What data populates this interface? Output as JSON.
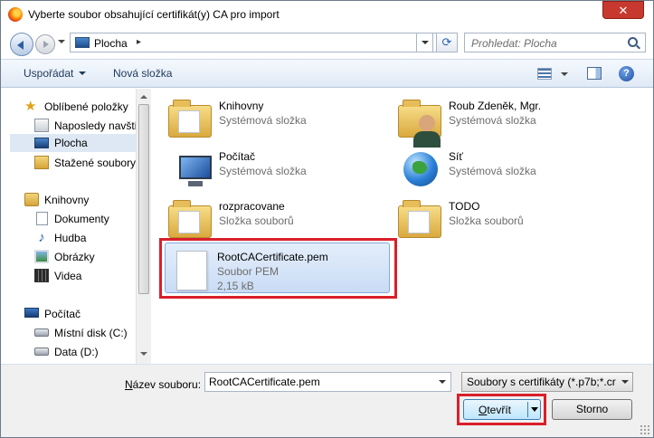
{
  "window": {
    "title": "Vyberte soubor obsahující certifikát(y) CA pro import",
    "close_label": "✕"
  },
  "address": {
    "location": "Plocha",
    "separator": "▸"
  },
  "search": {
    "placeholder": "Prohledat: Plocha"
  },
  "toolbar": {
    "organize_label": "Uspořádat",
    "new_folder_label": "Nová složka",
    "help_label": "?"
  },
  "sidebar": {
    "items": [
      {
        "label": "Oblíbené položky",
        "icon": "star-icon"
      },
      {
        "label": "Naposledy navšti",
        "icon": "recent-places-icon"
      },
      {
        "label": "Plocha",
        "icon": "desktop-icon",
        "selected": true
      },
      {
        "label": "Stažené soubory",
        "icon": "downloads-icon"
      },
      {
        "label": "Knihovny",
        "icon": "libraries-icon"
      },
      {
        "label": "Dokumenty",
        "icon": "documents-icon"
      },
      {
        "label": "Hudba",
        "icon": "music-icon"
      },
      {
        "label": "Obrázky",
        "icon": "pictures-icon"
      },
      {
        "label": "Videa",
        "icon": "videos-icon"
      },
      {
        "label": "Počítač",
        "icon": "computer-icon"
      },
      {
        "label": "Místní disk (C:)",
        "icon": "disk-icon"
      },
      {
        "label": "Data (D:)",
        "icon": "disk-icon"
      }
    ]
  },
  "files": [
    {
      "name": "Knihovny",
      "type": "Systémová složka",
      "icon": "libraries-folder-icon"
    },
    {
      "name": "Roub Zdeněk, Mgr.",
      "type": "Systémová složka",
      "icon": "user-folder-icon"
    },
    {
      "name": "Počítač",
      "type": "Systémová složka",
      "icon": "computer-icon"
    },
    {
      "name": "Síť",
      "type": "Systémová složka",
      "icon": "network-icon"
    },
    {
      "name": "rozpracovane",
      "type": "Složka souborů",
      "icon": "folder-icon"
    },
    {
      "name": "TODO",
      "type": "Složka souborů",
      "icon": "folder-icon"
    },
    {
      "name": "RootCACertificate.pem",
      "type": "Soubor PEM",
      "size": "2,15 kB",
      "icon": "pem-file-icon",
      "selected": true
    }
  ],
  "footer": {
    "filename_label_prefix": "N",
    "filename_label_rest": "ázev souboru:",
    "filename_value": "RootCACertificate.pem",
    "filter_value": "Soubory s certifikáty (*.p7b;*.cr",
    "open_label_prefix": "O",
    "open_label_rest": "tevřít",
    "cancel_label": "Storno"
  },
  "colors": {
    "highlight": "#d9202a",
    "accent": "#3c7fb1",
    "selection": "#c9dcf5"
  }
}
